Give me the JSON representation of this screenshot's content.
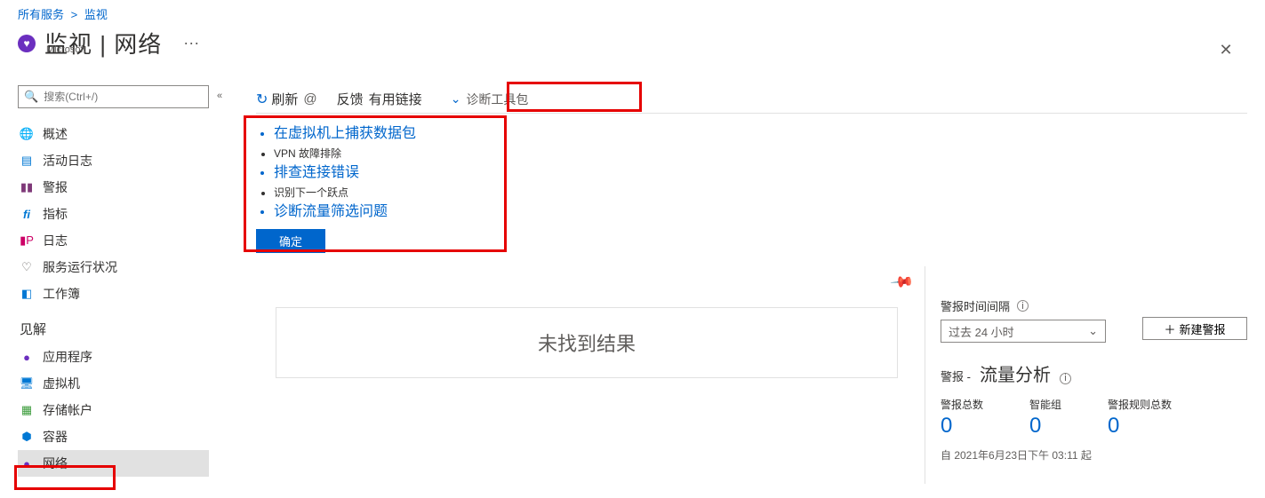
{
  "breadcrumb": {
    "root": "所有服务",
    "current": "监视"
  },
  "title": {
    "main": "监视 | 网络",
    "org": "Microsoft",
    "more": "···"
  },
  "search": {
    "placeholder": "搜索(Ctrl+/)"
  },
  "nav": {
    "items": [
      {
        "label": "概述"
      },
      {
        "label": "活动日志"
      },
      {
        "label": "警报"
      },
      {
        "label": "指标"
      },
      {
        "label": "日志"
      },
      {
        "label": "服务运行状况"
      },
      {
        "label": "工作簿"
      }
    ],
    "section": "见解",
    "insights": [
      {
        "label": "应用程序"
      },
      {
        "label": "虚拟机"
      },
      {
        "label": "存储帐户"
      },
      {
        "label": "容器"
      },
      {
        "label": "网络"
      }
    ]
  },
  "toolbar": {
    "refresh": "刷新",
    "at": "@",
    "feedback": "反馈",
    "links": "有用链接",
    "diag": "诊断工具包"
  },
  "diag_panel": {
    "items": [
      {
        "label": "在虚拟机上捕获数据包",
        "link": true
      },
      {
        "label": "VPN 故障排除",
        "link": false
      },
      {
        "label": "排查连接错误",
        "link": true
      },
      {
        "label": "识别下一个跃点",
        "link": false
      },
      {
        "label": "诊断流量筛选问题",
        "link": true
      }
    ],
    "ok": "确定"
  },
  "main": {
    "no_results": "未找到结果"
  },
  "right": {
    "interval_label": "警报时间间隔",
    "time_select": "过去 24 小时",
    "new_alert": "新建警报",
    "alerts_label": "警报 -",
    "alerts_name": "流量分析",
    "counts": [
      {
        "label": "警报总数",
        "value": "0"
      },
      {
        "label": "智能组",
        "value": "0"
      },
      {
        "label": "警报规则总数",
        "value": "0"
      }
    ],
    "since": "自 2021年6月23日下午 03:11 起"
  }
}
